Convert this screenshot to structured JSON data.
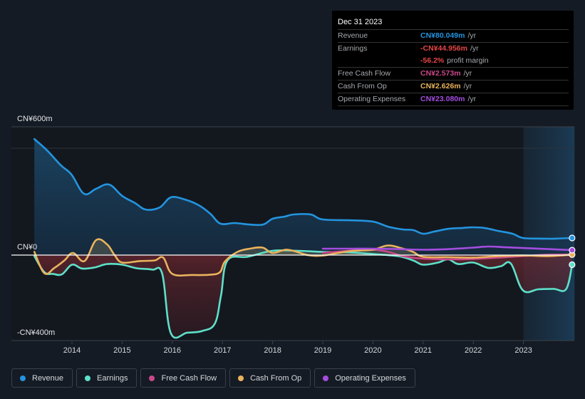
{
  "tooltip": {
    "date": "Dec 31 2023",
    "rows": [
      {
        "key": "Revenue",
        "value": "CN¥80.049m",
        "unit": "/yr",
        "color": "#2394df"
      },
      {
        "key": "Earnings",
        "value": "-CN¥44.956m",
        "unit": "/yr",
        "color": "#e64646"
      },
      {
        "key": "",
        "value": "-56.2%",
        "unit": "profit margin",
        "color": "#e64646"
      },
      {
        "key": "Free Cash Flow",
        "value": "CN¥2.573m",
        "unit": "/yr",
        "color": "#c9488a"
      },
      {
        "key": "Cash From Op",
        "value": "CN¥2.626m",
        "unit": "/yr",
        "color": "#e9b35d"
      },
      {
        "key": "Operating Expenses",
        "value": "CN¥23.080m",
        "unit": "/yr",
        "color": "#a44de0"
      }
    ]
  },
  "legend": [
    {
      "label": "Revenue",
      "color": "#2394df"
    },
    {
      "label": "Earnings",
      "color": "#5ee0c9"
    },
    {
      "label": "Free Cash Flow",
      "color": "#c9488a"
    },
    {
      "label": "Cash From Op",
      "color": "#e9b35d"
    },
    {
      "label": "Operating Expenses",
      "color": "#a44de0"
    }
  ],
  "chart_data": {
    "type": "area",
    "title": "",
    "xlabel": "",
    "ylabel": "",
    "y_unit": "CN¥ m",
    "ylim": [
      -400,
      600
    ],
    "xlim": [
      2013.25,
      2023.99
    ],
    "grid": true,
    "legend_position": "bottom-left",
    "highlight_range": [
      2023.0,
      2023.99
    ],
    "y_tick_labels": [
      {
        "value": 600,
        "label": "CN¥600m"
      },
      {
        "value": 0,
        "label": "CN¥0"
      },
      {
        "value": -400,
        "label": "-CN¥400m"
      }
    ],
    "x_ticks": [
      2014,
      2015,
      2016,
      2017,
      2018,
      2019,
      2020,
      2021,
      2022,
      2023
    ],
    "x_tick_labels": [
      "2014",
      "2015",
      "2016",
      "2017",
      "2018",
      "2019",
      "2020",
      "2021",
      "2022",
      "2023"
    ],
    "series": [
      {
        "name": "Revenue",
        "color": "#2394df",
        "fill": true,
        "end_marker": true,
        "x": [
          2013.25,
          2013.49,
          2013.78,
          2013.99,
          2014.24,
          2014.48,
          2014.74,
          2015.0,
          2015.26,
          2015.47,
          2015.75,
          2015.97,
          2016.25,
          2016.53,
          2016.76,
          2016.96,
          2017.24,
          2017.53,
          2017.81,
          2018.0,
          2018.24,
          2018.42,
          2018.76,
          2018.99,
          2019.52,
          2019.99,
          2020.3,
          2020.59,
          2020.8,
          2021.0,
          2021.22,
          2021.51,
          2021.79,
          2021.99,
          2022.22,
          2022.5,
          2022.78,
          2022.99,
          2023.35,
          2023.64,
          2023.97
        ],
        "values": [
          543,
          493,
          420,
          377,
          287,
          310,
          330,
          277,
          243,
          213,
          223,
          270,
          260,
          233,
          193,
          147,
          150,
          143,
          143,
          170,
          180,
          190,
          190,
          167,
          163,
          157,
          133,
          120,
          117,
          100,
          110,
          123,
          127,
          130,
          127,
          113,
          100,
          80,
          77,
          77,
          80
        ]
      },
      {
        "name": "Earnings",
        "color": "#5ee0c9",
        "fill": false,
        "end_marker": true,
        "x": [
          2013.25,
          2013.45,
          2013.62,
          2013.8,
          2014.0,
          2014.2,
          2014.45,
          2014.7,
          2015.0,
          2015.3,
          2015.6,
          2015.8,
          2015.97,
          2016.3,
          2016.6,
          2016.85,
          2016.97,
          2017.1,
          2017.5,
          2018.0,
          2018.5,
          2019.0,
          2019.5,
          2020.0,
          2020.5,
          2020.8,
          2021.0,
          2021.3,
          2021.5,
          2021.7,
          2022.0,
          2022.3,
          2022.55,
          2022.75,
          2022.99,
          2023.3,
          2023.6,
          2023.85,
          2023.97
        ],
        "values": [
          -5,
          -80,
          -88,
          -90,
          -45,
          -63,
          -58,
          -42,
          -45,
          -62,
          -68,
          -88,
          -365,
          -363,
          -355,
          -320,
          -190,
          -25,
          -8,
          20,
          20,
          15,
          13,
          5,
          -5,
          -25,
          -45,
          -35,
          -20,
          -42,
          -35,
          -60,
          -52,
          -40,
          -165,
          -160,
          -158,
          -160,
          -45
        ]
      },
      {
        "name": "Free Cash Flow",
        "color": "#c9488a",
        "fill": false,
        "end_marker": false,
        "x": [
          2019.0,
          2019.5,
          2020.0,
          2020.3,
          2020.6,
          2020.9,
          2021.2,
          2021.6,
          2022.0,
          2022.5,
          2022.99,
          2023.5,
          2023.97
        ],
        "values": [
          10,
          20,
          25,
          15,
          -5,
          -15,
          -18,
          -20,
          -18,
          -12,
          -5,
          2,
          3
        ]
      },
      {
        "name": "Cash From Op",
        "color": "#e9b35d",
        "fill": false,
        "end_marker": true,
        "x": [
          2013.25,
          2013.45,
          2013.65,
          2013.85,
          2014.02,
          2014.25,
          2014.48,
          2014.7,
          2014.85,
          2015.0,
          2015.35,
          2015.65,
          2015.82,
          2016.0,
          2016.4,
          2016.75,
          2016.95,
          2017.05,
          2017.3,
          2017.55,
          2017.8,
          2018.0,
          2018.3,
          2018.7,
          2019.0,
          2019.3,
          2019.6,
          2020.0,
          2020.3,
          2020.6,
          2020.8,
          2021.0,
          2021.5,
          2022.0,
          2022.5,
          2022.99,
          2023.5,
          2023.97
        ],
        "values": [
          15,
          -85,
          -60,
          -25,
          10,
          -28,
          70,
          50,
          0,
          -35,
          -28,
          -25,
          -12,
          -88,
          -93,
          -92,
          -80,
          -30,
          15,
          30,
          35,
          10,
          25,
          0,
          -2,
          10,
          20,
          25,
          45,
          30,
          15,
          -8,
          -10,
          -12,
          -5,
          -2,
          -5,
          2
        ]
      },
      {
        "name": "Operating Expenses",
        "color": "#a44de0",
        "fill": false,
        "end_marker": true,
        "x": [
          2019.0,
          2019.5,
          2020.0,
          2020.5,
          2021.0,
          2021.5,
          2022.0,
          2022.3,
          2022.6,
          2022.99,
          2023.5,
          2023.97
        ],
        "values": [
          30,
          30,
          30,
          28,
          25,
          28,
          35,
          40,
          37,
          33,
          28,
          23
        ]
      }
    ]
  }
}
